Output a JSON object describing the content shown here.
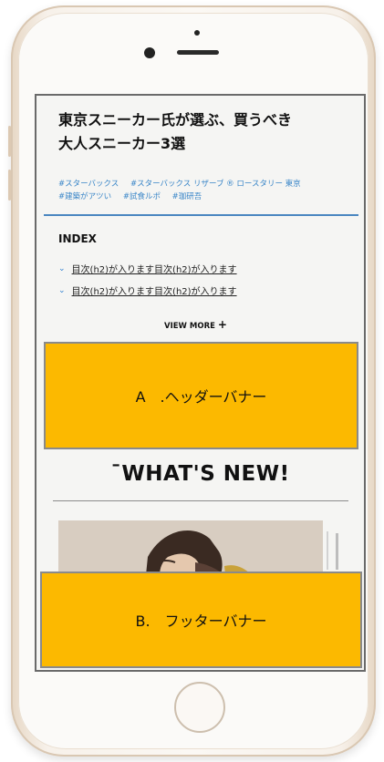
{
  "article": {
    "title_line1": "東京スニーカー氏が選ぶ、買うべき",
    "title_line2": "大人スニーカー3選",
    "tags": [
      "#スターバックス",
      "#スターバックス リザーブ ® ロースタリー 東京",
      "#建築がアツい",
      "#試食ルポ",
      "#珈研吾"
    ]
  },
  "index": {
    "heading": "INDEX",
    "items": [
      "目次(h2)が入ります目次(h2)が入ります",
      "目次(h2)が入ります目次(h2)が入ります"
    ],
    "view_more": "VIEW MORE",
    "view_more_icon": "plus-icon"
  },
  "banner_header": {
    "label": "A　.ヘッダーバナー",
    "color": "#fcb900"
  },
  "whats_new": {
    "heading": "WHAT'S NEW!",
    "prefix": "¯"
  },
  "banner_footer": {
    "label": "B.　フッターバナー",
    "color": "#fcb900"
  },
  "colors": {
    "accent": "#3a86c8",
    "rule": "#4a86c0",
    "phone_frame": "#f7f1ea"
  }
}
